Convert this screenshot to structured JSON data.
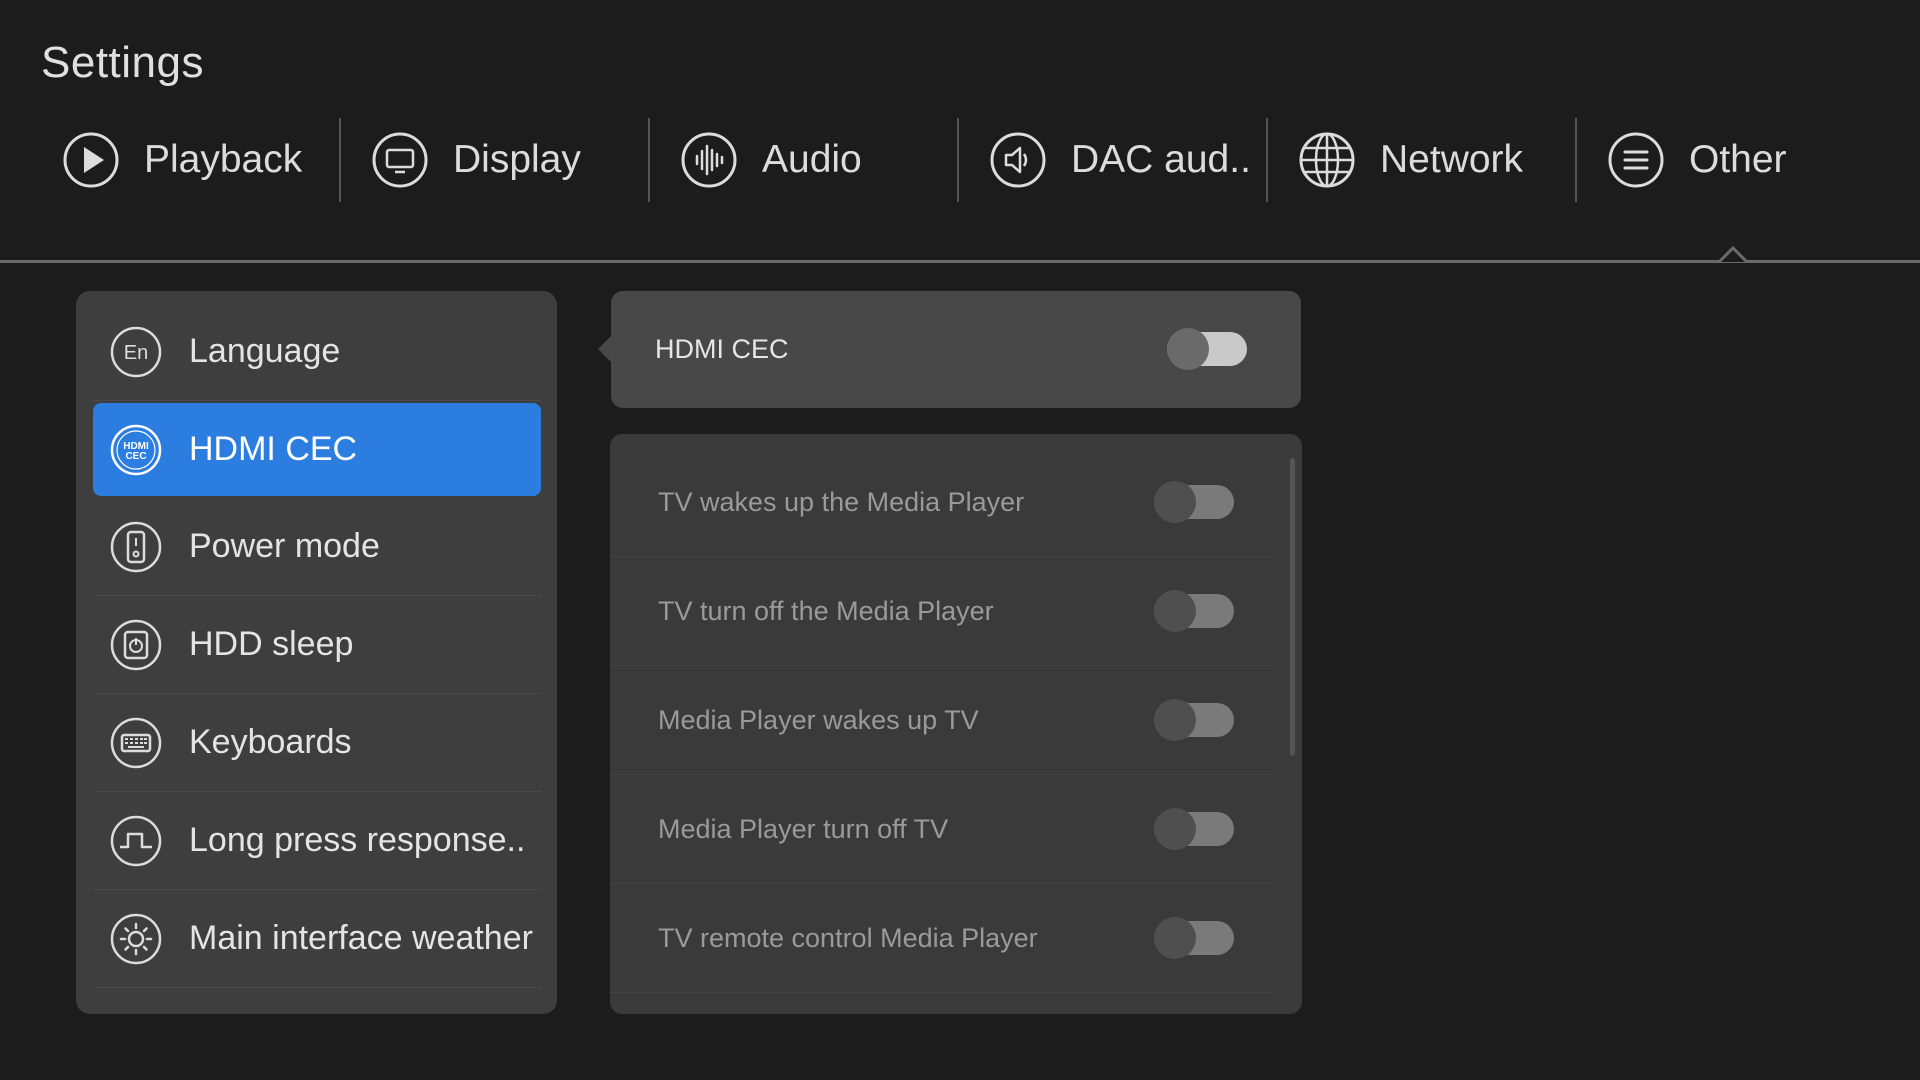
{
  "header": {
    "title": "Settings"
  },
  "tabs": [
    {
      "label": "Playback",
      "icon": "play-icon"
    },
    {
      "label": "Display",
      "icon": "monitor-icon"
    },
    {
      "label": "Audio",
      "icon": "audio-wave-icon"
    },
    {
      "label": "DAC aud..",
      "icon": "speaker-icon"
    },
    {
      "label": "Network",
      "icon": "globe-icon"
    },
    {
      "label": "Other",
      "icon": "menu-lines-icon",
      "selected": true
    }
  ],
  "side_menu": {
    "items": [
      {
        "label": "Language",
        "icon": "language-en-icon",
        "icon_text": "En"
      },
      {
        "label": "HDMI CEC",
        "icon": "hdmi-cec-icon",
        "icon_text": "HDMI CEC",
        "active": true
      },
      {
        "label": "Power mode",
        "icon": "power-remote-icon"
      },
      {
        "label": "HDD sleep",
        "icon": "hdd-timer-icon"
      },
      {
        "label": "Keyboards",
        "icon": "keyboard-icon"
      },
      {
        "label": "Long press response..",
        "icon": "pulse-icon"
      },
      {
        "label": "Main interface weather",
        "icon": "weather-sun-icon"
      }
    ]
  },
  "detail": {
    "main_toggle": {
      "label": "HDMI CEC",
      "on": false
    },
    "options": [
      {
        "label": "TV wakes up the Media Player",
        "on": false
      },
      {
        "label": "TV turn off the Media Player",
        "on": false
      },
      {
        "label": "Media Player wakes up TV",
        "on": false
      },
      {
        "label": "Media Player turn off TV",
        "on": false
      },
      {
        "label": "TV remote control Media Player",
        "on": false
      }
    ]
  },
  "colors": {
    "background": "#1c1c1c",
    "accent": "#2b7ddf",
    "panel": "#3e3e3e"
  }
}
